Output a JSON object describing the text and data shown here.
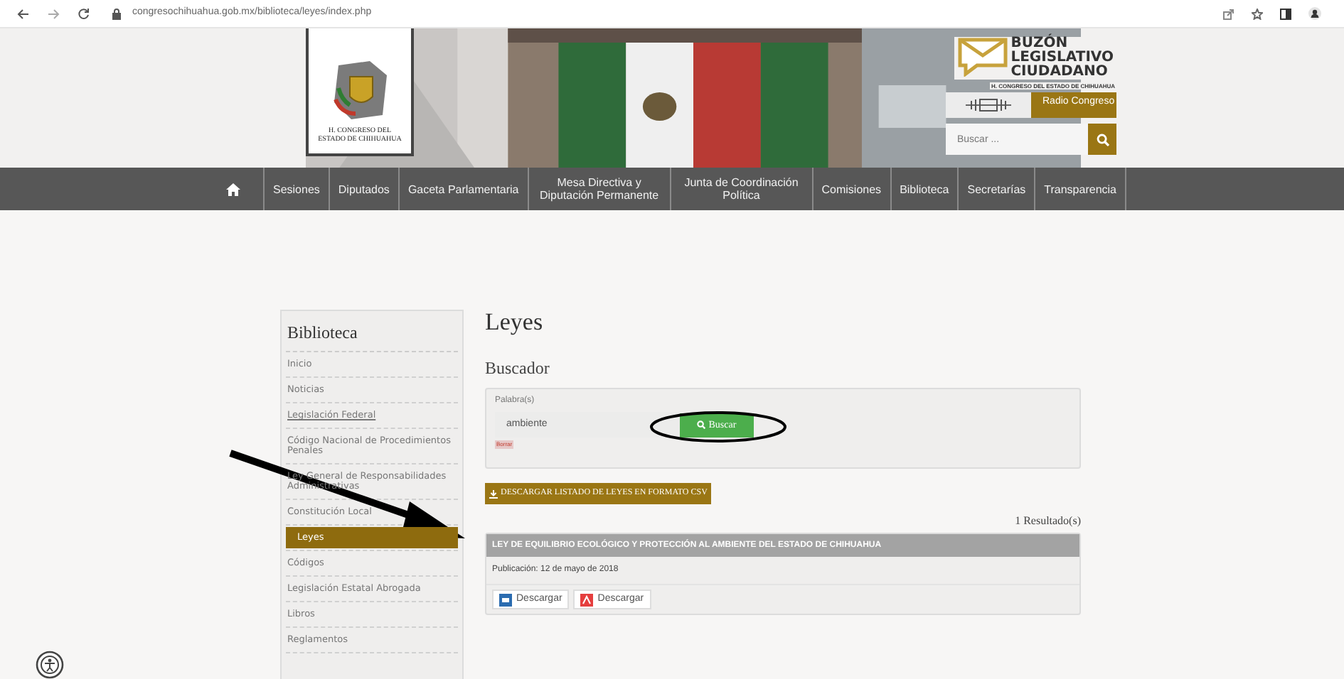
{
  "browser": {
    "url": "congresochihuahua.gob.mx/biblioteca/leyes/index.php"
  },
  "header": {
    "logo_caption": "H. CONGRESO DEL ESTADO DE CHIHUAHUA",
    "buzon_lines": [
      "BUZÓN",
      "LEGISLATIVO",
      "CIUDADANO"
    ],
    "buzon_subtitle": "H. CONGRESO DEL ESTADO DE CHIHUAHUA",
    "radio": "Radio Congreso",
    "search": {
      "placeholder": "Buscar ..."
    }
  },
  "nav": [
    {
      "kind": "home"
    },
    {
      "kind": "text",
      "label": "Sesiones"
    },
    {
      "kind": "text",
      "label": "Diputados"
    },
    {
      "kind": "text",
      "label": "Gaceta Parlamentaria"
    },
    {
      "kind": "text",
      "label": "Mesa Directiva y Diputación Permanente"
    },
    {
      "kind": "text",
      "label": "Junta de Coordinación Política"
    },
    {
      "kind": "text",
      "label": "Comisiones"
    },
    {
      "kind": "text",
      "label": "Biblioteca"
    },
    {
      "kind": "text",
      "label": "Secretarías"
    },
    {
      "kind": "text",
      "label": "Transparencia"
    }
  ],
  "sidebar": {
    "title": "Biblioteca",
    "items": [
      {
        "label": "Inicio",
        "selected": false,
        "underlined": false
      },
      {
        "label": "Noticias",
        "selected": false,
        "underlined": false
      },
      {
        "label": "Legislación Federal",
        "selected": false,
        "underlined": true
      },
      {
        "label": "Código Nacional de Procedimientos Penales",
        "selected": false,
        "underlined": false
      },
      {
        "label": "Ley General de Responsabilidades Administrativas",
        "selected": false,
        "underlined": false
      },
      {
        "label": "Constitución Local",
        "selected": false,
        "underlined": false
      },
      {
        "label": "Leyes",
        "selected": true,
        "underlined": false
      },
      {
        "label": "Códigos",
        "selected": false,
        "underlined": false
      },
      {
        "label": "Legislación Estatal Abrogada",
        "selected": false,
        "underlined": false
      },
      {
        "label": "Libros",
        "selected": false,
        "underlined": false
      },
      {
        "label": "Reglamentos",
        "selected": false,
        "underlined": false
      }
    ]
  },
  "main": {
    "title": "Leyes",
    "search_title": "Buscador",
    "field_label": "Palabra(s)",
    "field_value": "ambiente",
    "search_button": "Buscar",
    "clear_button": "Borrar",
    "csv_button": "DESCARGAR LISTADO DE LEYES EN FORMATO CSV",
    "result_count": "1 Resultado(s)",
    "results": [
      {
        "title": "LEY DE EQUILIBRIO ECOLÓGICO Y PROTECCIÓN AL AMBIENTE DEL ESTADO DE CHIHUAHUA",
        "publication": "Publicación: 12 de mayo de 2018",
        "downloads": [
          {
            "kind": "word",
            "label": "Descargar"
          },
          {
            "kind": "pdf",
            "label": "Descargar"
          }
        ]
      }
    ]
  }
}
